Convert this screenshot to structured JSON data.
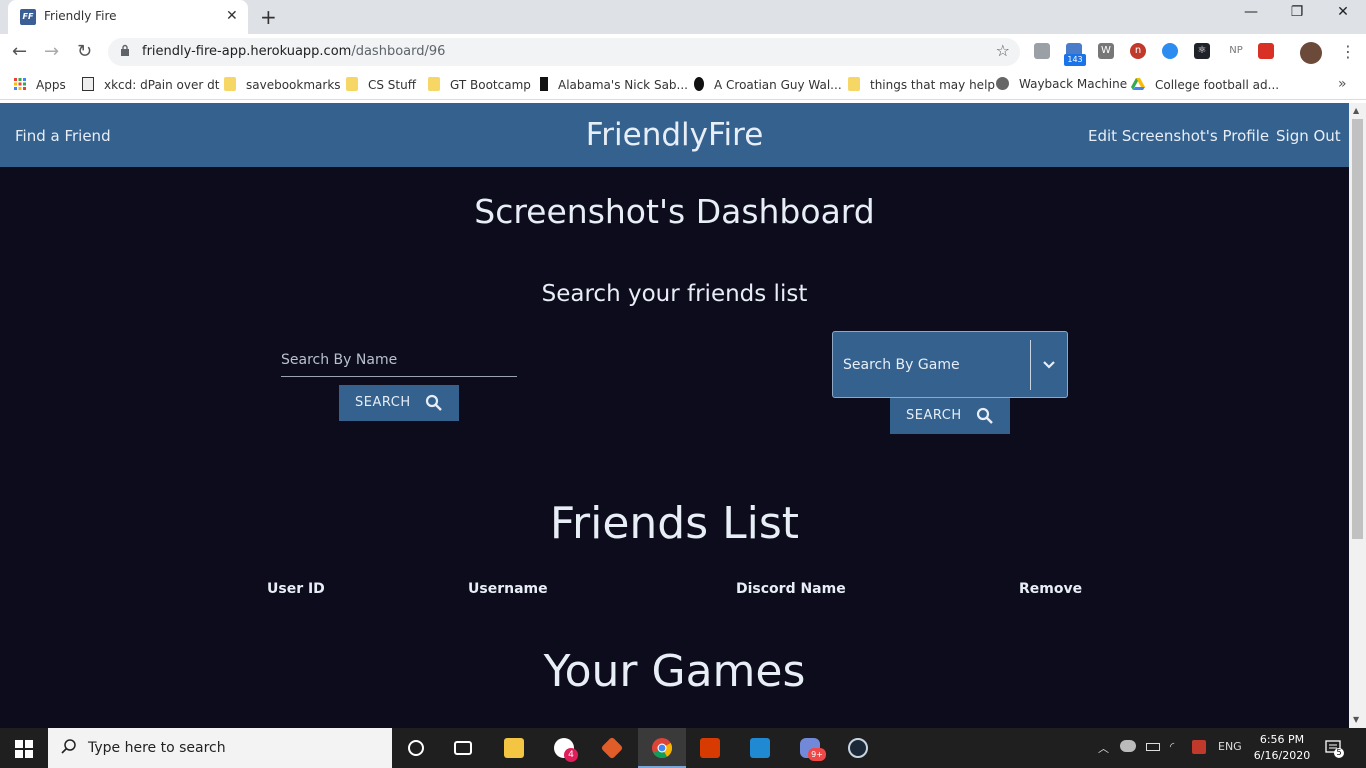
{
  "browser": {
    "tab_title": "Friendly Fire",
    "tab_favicon_text": "FF",
    "url_host": "friendly-fire-app.herokuapp.com",
    "url_path": "/dashboard/96",
    "extension_badge": "143",
    "bookmarks": [
      {
        "label": "Apps"
      },
      {
        "label": "xkcd: dPain over dt"
      },
      {
        "label": "savebookmarks"
      },
      {
        "label": "CS Stuff"
      },
      {
        "label": "GT Bootcamp"
      },
      {
        "label": "Alabama's Nick Sab..."
      },
      {
        "label": "A Croatian Guy Wal..."
      },
      {
        "label": "things that may help"
      },
      {
        "label": "Wayback Machine"
      },
      {
        "label": "College football ad..."
      }
    ]
  },
  "site": {
    "nav": {
      "find_friend": "Find a Friend",
      "brand": "FriendlyFire",
      "edit_profile": "Edit Screenshot's Profile",
      "sign_out": "Sign Out"
    },
    "dashboard_title": "Screenshot's Dashboard",
    "search_heading": "Search your friends list",
    "search_name_placeholder": "Search By Name",
    "search_button": "SEARCH",
    "search_game_placeholder": "Search By Game",
    "friends_list_title": "Friends List",
    "columns": [
      "User ID",
      "Username",
      "Discord Name",
      "Remove"
    ],
    "your_games_title": "Your Games"
  },
  "taskbar": {
    "search_placeholder": "Type here to search",
    "language": "ENG",
    "time": "6:56 PM",
    "date": "6/16/2020",
    "notification_count": "5",
    "badge_slack": "4",
    "badge_discord": "9+"
  },
  "colors": {
    "nav_bg": "#34618e",
    "page_bg": "#0d0c1d",
    "text": "#e8eef6"
  }
}
